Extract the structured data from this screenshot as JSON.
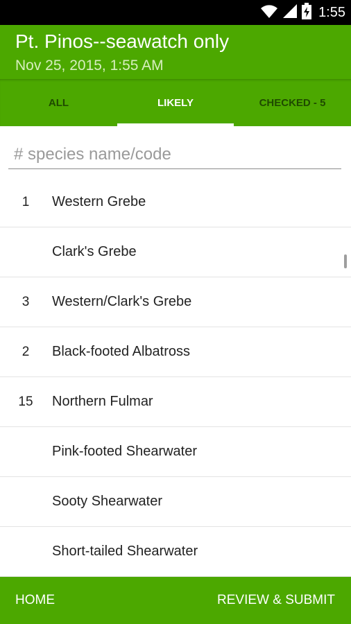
{
  "status_bar": {
    "time": "1:55",
    "icons": [
      "wifi-icon",
      "signal-icon",
      "battery-charging-icon"
    ]
  },
  "header": {
    "title": "Pt. Pinos--seawatch only",
    "subtitle": "Nov 25, 2015, 1:55 AM"
  },
  "tabs": [
    {
      "label": "ALL",
      "active": false
    },
    {
      "label": "LIKELY",
      "active": true
    },
    {
      "label": "CHECKED - 5",
      "active": false
    }
  ],
  "search": {
    "placeholder": "# species name/code",
    "value": ""
  },
  "species": [
    {
      "count": "1",
      "name": "Western Grebe"
    },
    {
      "count": "",
      "name": "Clark's Grebe"
    },
    {
      "count": "3",
      "name": "Western/Clark's Grebe"
    },
    {
      "count": "2",
      "name": "Black-footed Albatross"
    },
    {
      "count": "15",
      "name": "Northern Fulmar"
    },
    {
      "count": "",
      "name": "Pink-footed Shearwater"
    },
    {
      "count": "",
      "name": "Sooty Shearwater"
    },
    {
      "count": "",
      "name": "Short-tailed Shearwater"
    }
  ],
  "bottom_bar": {
    "home_label": "HOME",
    "review_label": "REVIEW & SUBMIT"
  },
  "colors": {
    "primary": "#4ca800",
    "tab_inactive_text": "#1f4a00",
    "status_bar": "#000000"
  }
}
